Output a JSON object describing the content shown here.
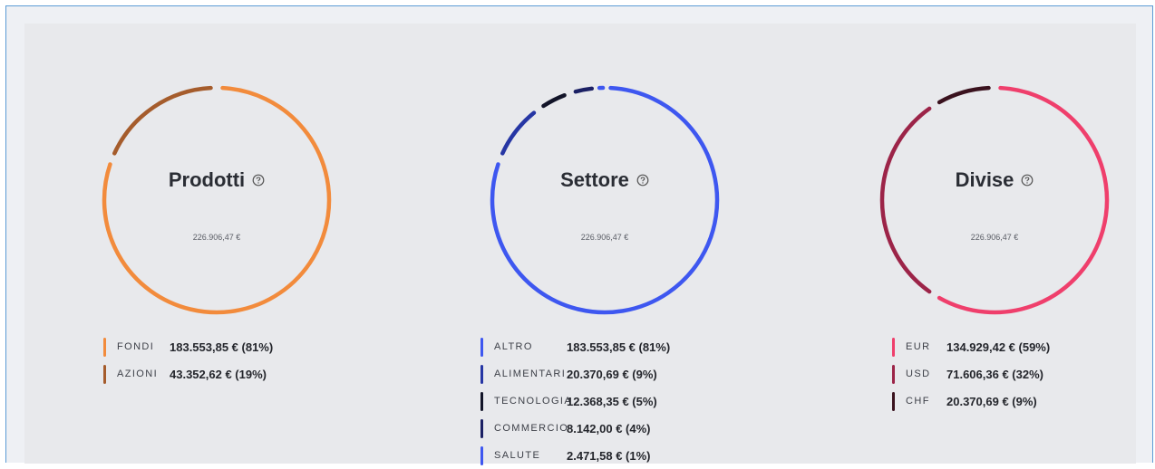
{
  "widgets": [
    {
      "title": "Prodotti",
      "help_icon": "question-circle-icon",
      "total": "226.906,47 €",
      "items": [
        {
          "label": "FONDI",
          "value": "183.553,85 € (81%)",
          "percent": 81,
          "color": "#f28b3c"
        },
        {
          "label": "AZIONI",
          "value": "43.352,62 € (19%)",
          "percent": 19,
          "color": "#a55c2c"
        }
      ]
    },
    {
      "title": "Settore",
      "help_icon": "question-circle-icon",
      "total": "226.906,47 €",
      "items": [
        {
          "label": "ALTRO",
          "value": "183.553,85 € (81%)",
          "percent": 81,
          "color": "#3e57f0"
        },
        {
          "label": "ALIMENTARI",
          "value": "20.370,69 € (9%)",
          "percent": 9,
          "color": "#2636a4"
        },
        {
          "label": "TECNOLOGIA",
          "value": "12.368,35 € (5%)",
          "percent": 5,
          "color": "#121428"
        },
        {
          "label": "COMMERCIO",
          "value": "8.142,00 € (4%)",
          "percent": 4,
          "color": "#1b2064"
        },
        {
          "label": "SALUTE",
          "value": "2.471,58 € (1%)",
          "percent": 1,
          "color": "#3e57f0"
        }
      ]
    },
    {
      "title": "Divise",
      "help_icon": "question-circle-icon",
      "total": "226.906,47 €",
      "items": [
        {
          "label": "EUR",
          "value": "134.929,42 € (59%)",
          "percent": 59,
          "color": "#ef3f6c"
        },
        {
          "label": "USD",
          "value": "71.606,36 € (32%)",
          "percent": 32,
          "color": "#9c2448"
        },
        {
          "label": "CHF",
          "value": "20.370,69 € (9%)",
          "percent": 9,
          "color": "#3a121e"
        }
      ]
    }
  ],
  "chart_data": [
    {
      "type": "pie",
      "title": "Prodotti",
      "total": "226.906,47 €",
      "categories": [
        "FONDI",
        "AZIONI"
      ],
      "values": [
        183553.85,
        43352.62
      ],
      "percents": [
        81,
        19
      ]
    },
    {
      "type": "pie",
      "title": "Settore",
      "total": "226.906,47 €",
      "categories": [
        "ALTRO",
        "ALIMENTARI",
        "TECNOLOGIA",
        "COMMERCIO",
        "SALUTE"
      ],
      "values": [
        183553.85,
        20370.69,
        12368.35,
        8142.0,
        2471.58
      ],
      "percents": [
        81,
        9,
        5,
        4,
        1
      ]
    },
    {
      "type": "pie",
      "title": "Divise",
      "total": "226.906,47 €",
      "categories": [
        "EUR",
        "USD",
        "CHF"
      ],
      "values": [
        134929.42,
        71606.36,
        20370.69
      ],
      "percents": [
        59,
        32,
        9
      ]
    }
  ]
}
